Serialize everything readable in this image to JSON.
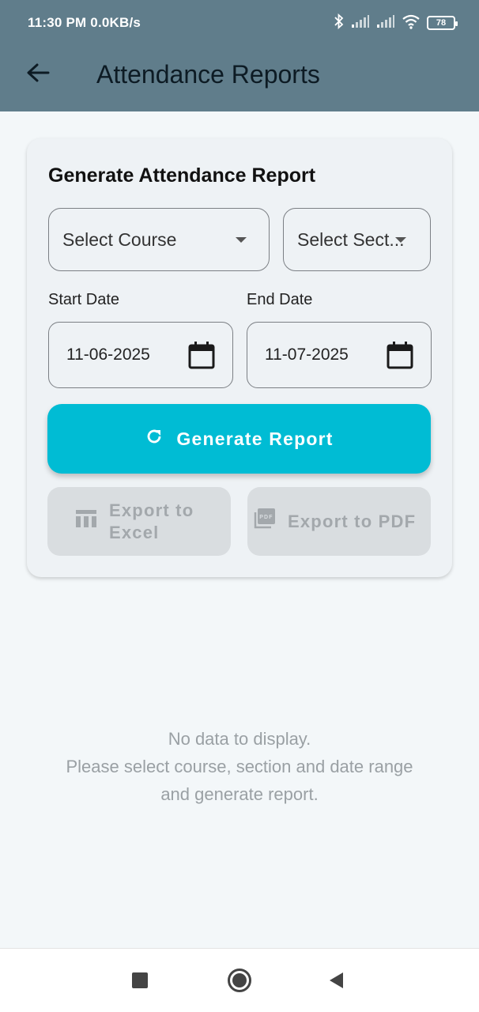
{
  "status_bar": {
    "time": "11:30 PM  0.0KB/s",
    "battery": "78",
    "icons": [
      "bluetooth-icon",
      "signal-icon",
      "signal-icon",
      "wifi-icon",
      "battery-icon"
    ]
  },
  "app_bar": {
    "title": "Attendance Reports",
    "back_icon": "arrow-left-icon"
  },
  "form": {
    "title": "Generate Attendance Report",
    "course_select": "Select Course",
    "section_select": "Select Sect...",
    "start_date_label": "Start Date",
    "end_date_label": "End Date",
    "start_date": "11-06-2025",
    "end_date": "11-07-2025",
    "generate_label": "Generate Report",
    "export_excel_line1": "Export to",
    "export_excel_line2": "Excel",
    "export_pdf_label": "Export to PDF"
  },
  "empty_state": {
    "line1": "No data to display.",
    "line2": "Please select course, section and date range",
    "line3": "and generate report."
  },
  "colors": {
    "app_bar": "#607d8b",
    "primary_button": "#00bcd4",
    "disabled_button": "#d9dde0",
    "background": "#f3f7f9"
  }
}
